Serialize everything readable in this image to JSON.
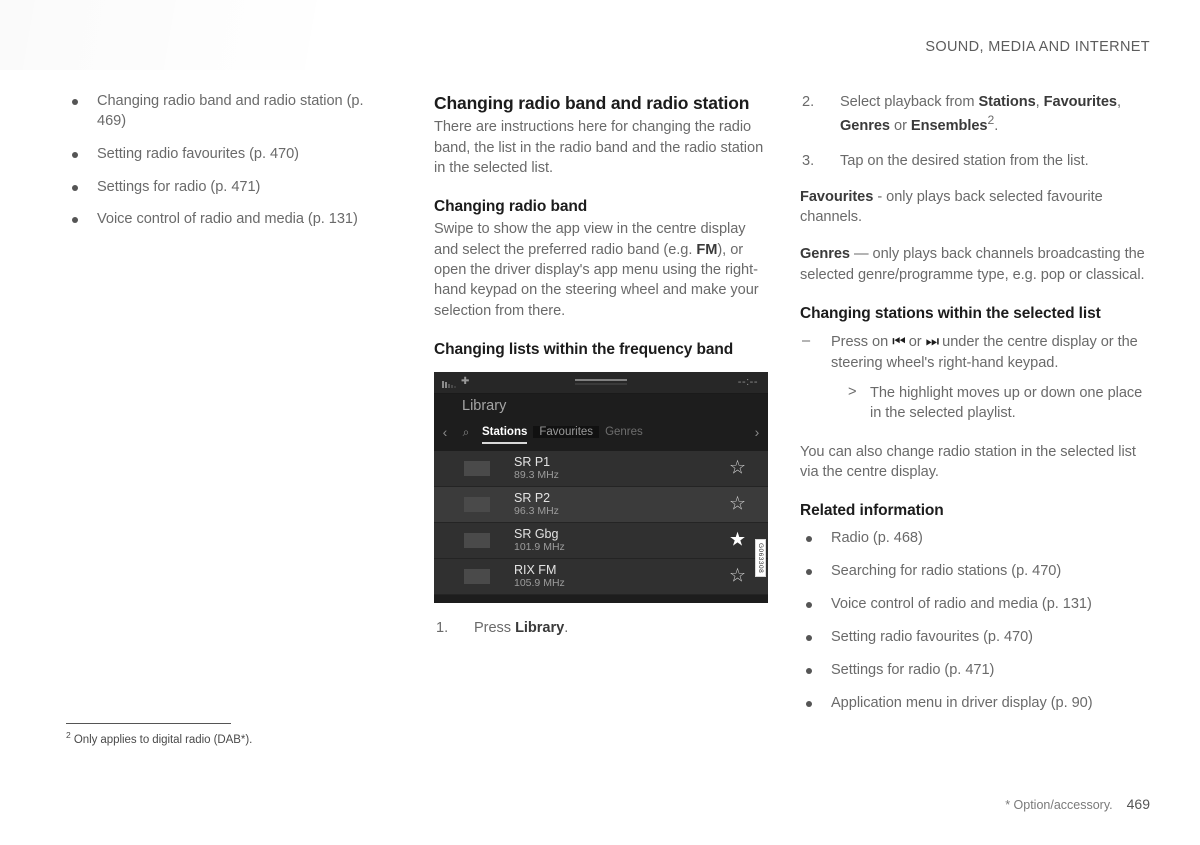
{
  "header": {
    "title": "SOUND, MEDIA AND INTERNET"
  },
  "left_column": {
    "bullets": [
      "Changing radio band and radio station (p. 469)",
      "Setting radio favourites (p. 470)",
      "Settings for radio (p. 471)",
      "Voice control of radio and media (p. 131)"
    ]
  },
  "middle_column": {
    "heading": "Changing radio band and radio station",
    "intro": "There are instructions here for changing the radio band, the list in the radio band and the radio station in the selected list.",
    "subheading_band": "Changing radio band",
    "band_text_1": "Swipe to show the app view in the centre display and select the preferred radio band (e.g. ",
    "band_text_bold": "FM",
    "band_text_2": "), or open the driver display's app menu using the right-hand keypad on the steering wheel and make your selection from there.",
    "subheading_lists": "Changing lists within the frequency band",
    "figure": {
      "status": {
        "signal_icon": "signal-bars-icon",
        "bluetooth_icon": "bluetooth-icon",
        "clock": "--:--"
      },
      "title": "Library",
      "prev_icon": "chevron-left-icon",
      "search_icon": "search-icon",
      "next_icon": "chevron-right-icon",
      "tabs": [
        {
          "label": "Stations",
          "state": "active"
        },
        {
          "label": "Favourites",
          "state": "boxed"
        },
        {
          "label": "Genres",
          "state": "plain"
        }
      ],
      "stations": [
        {
          "name": "SR P1",
          "freq": "89.3 MHz",
          "favourite": false
        },
        {
          "name": "SR P2",
          "freq": "96.3 MHz",
          "favourite": false
        },
        {
          "name": "SR Gbg",
          "freq": "101.9 MHz",
          "favourite": true
        },
        {
          "name": "RIX FM",
          "freq": "105.9 MHz",
          "favourite": false
        }
      ],
      "code": "G063308"
    },
    "step_1": {
      "num": "1.",
      "text_pre": "Press ",
      "text_bold": "Library",
      "text_post": "."
    }
  },
  "right_column": {
    "step_2": {
      "num": "2.",
      "pre": "Select playback from ",
      "b1": "Stations",
      "mid1": ", ",
      "b2": "Favourites",
      "mid2": ", ",
      "b3": "Genres",
      "mid3": " or ",
      "b4": "Ensembles",
      "sup": "2",
      "post": "."
    },
    "step_3": {
      "num": "3.",
      "text": "Tap on the desired station from the list."
    },
    "favourites_term": "Favourites",
    "favourites_text": " - only plays back selected favourite channels.",
    "genres_term": "Genres",
    "genres_text": " — only plays back channels broadcasting the selected genre/programme type, e.g. pop or classical.",
    "subheading_stations": "Changing stations within the selected list",
    "press_pre": "Press on ",
    "press_icon_prev": "⏮",
    "press_mid": " or ",
    "press_icon_next": "⏭",
    "press_post": " under the centre display or the steering wheel's right-hand keypad.",
    "result": "The highlight moves up or down one place in the selected playlist.",
    "closing": "You can also change radio station in the selected list via the centre display.",
    "related_heading": "Related information",
    "related": [
      "Radio (p. 468)",
      "Searching for radio stations (p. 470)",
      "Voice control of radio and media (p. 131)",
      "Setting radio favourites (p. 470)",
      "Settings for radio (p. 471)",
      "Application menu in driver display (p. 90)"
    ]
  },
  "footnote": {
    "marker": "2",
    "text": "Only applies to digital radio (DAB*)."
  },
  "footer": {
    "option_note": "* Option/accessory.",
    "page_number": "469"
  }
}
